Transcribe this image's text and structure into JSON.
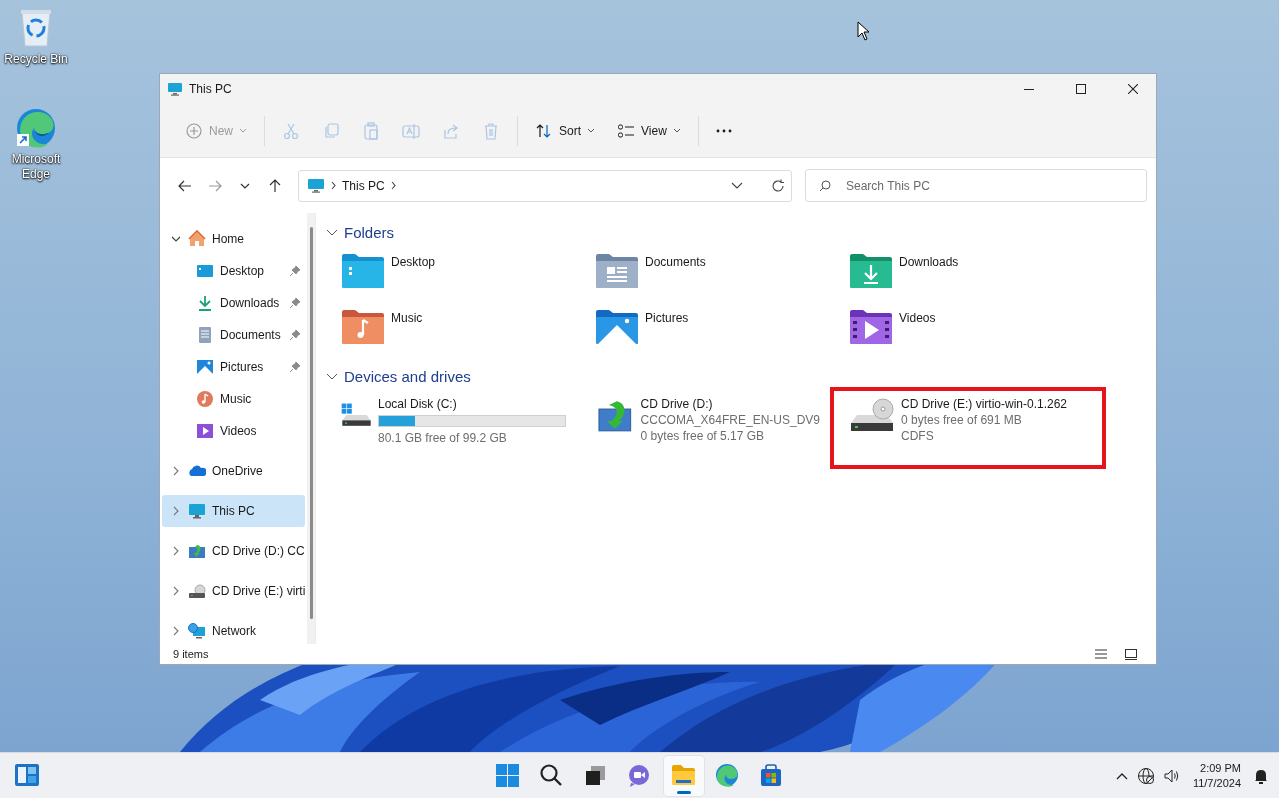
{
  "desktop_icons": [
    {
      "kind": "recycle",
      "label": "Recycle Bin"
    },
    {
      "kind": "edge",
      "label": "Microsoft Edge"
    }
  ],
  "window": {
    "title": "This PC"
  },
  "toolbar": [
    {
      "kind": "new",
      "label": "New",
      "disabled": true
    },
    {
      "kind": "cut",
      "disabled": true
    },
    {
      "kind": "copy",
      "disabled": true
    },
    {
      "kind": "paste",
      "disabled": true
    },
    {
      "kind": "rename",
      "disabled": true
    },
    {
      "kind": "share",
      "disabled": true
    },
    {
      "kind": "delete",
      "disabled": true
    },
    {
      "kind": "sort",
      "label": "Sort",
      "disabled": false
    },
    {
      "kind": "view",
      "label": "View",
      "disabled": false
    },
    {
      "kind": "more",
      "disabled": false
    }
  ],
  "navigation": {
    "back_disabled": false,
    "forward_disabled": true,
    "address": [
      "This PC"
    ],
    "search": {
      "placeholder": "Search This PC"
    }
  },
  "sidebar": {
    "items": [
      {
        "kind": "home",
        "label": "Home",
        "expanded": true,
        "selected": false,
        "children": [
          {
            "kind": "desktop",
            "label": "Desktop",
            "pinned": true,
            "selected": false
          },
          {
            "kind": "downloads",
            "label": "Downloads",
            "pinned": true,
            "selected": false
          },
          {
            "kind": "documents",
            "label": "Documents",
            "pinned": true,
            "selected": false
          },
          {
            "kind": "pictures",
            "label": "Pictures",
            "pinned": true,
            "selected": false
          },
          {
            "kind": "music",
            "label": "Music",
            "pinned": false,
            "selected": false
          },
          {
            "kind": "videos",
            "label": "Videos",
            "pinned": false,
            "selected": false
          }
        ]
      },
      {
        "kind": "onedrive",
        "label": "OneDrive",
        "expanded": false,
        "selected": false
      },
      {
        "kind": "pc",
        "label": "This PC",
        "expanded": false,
        "selected": true
      },
      {
        "kind": "cd_install",
        "label": "CD Drive (D:) CC",
        "expanded": false,
        "selected": false
      },
      {
        "kind": "cd_disk",
        "label": "CD Drive (E:) virti",
        "expanded": false,
        "selected": false
      },
      {
        "kind": "network",
        "label": "Network",
        "expanded": false,
        "selected": false
      }
    ]
  },
  "sections": [
    {
      "title": "Folders",
      "expanded": true,
      "kind": "folders",
      "items": [
        {
          "kind": "desktop",
          "label": "Desktop"
        },
        {
          "kind": "documents",
          "label": "Documents"
        },
        {
          "kind": "downloads",
          "label": "Downloads"
        },
        {
          "kind": "music",
          "label": "Music"
        },
        {
          "kind": "pictures",
          "label": "Pictures"
        },
        {
          "kind": "videos",
          "label": "Videos"
        }
      ]
    },
    {
      "title": "Devices and drives",
      "expanded": true,
      "kind": "drives",
      "items": [
        {
          "kind": "windows_disk",
          "name": "Local Disk (C:)",
          "level": 0.193,
          "details": [
            "80.1 GB free of 99.2 GB"
          ],
          "highlighted": false
        },
        {
          "kind": "cd_install",
          "name": "CD Drive (D:)",
          "details": [
            "CCCOMA_X64FRE_EN-US_DV9",
            "0 bytes free of 5.17 GB"
          ],
          "highlighted": false
        },
        {
          "kind": "cd_disk",
          "name": "CD Drive (E:) virtio-win-0.1.262",
          "details": [
            "0 bytes free of 691 MB",
            "CDFS"
          ],
          "highlighted": true
        }
      ]
    }
  ],
  "status_bar": {
    "count": "9 items"
  },
  "taskbar": {
    "apps": [
      {
        "kind": "start",
        "active": false
      },
      {
        "kind": "search",
        "active": false
      },
      {
        "kind": "taskview",
        "active": false
      },
      {
        "kind": "chat",
        "active": false
      },
      {
        "kind": "explorer",
        "active": true
      },
      {
        "kind": "edge",
        "active": false
      },
      {
        "kind": "store",
        "active": false
      }
    ],
    "time": "2:09 PM",
    "date": "11/7/2024"
  }
}
